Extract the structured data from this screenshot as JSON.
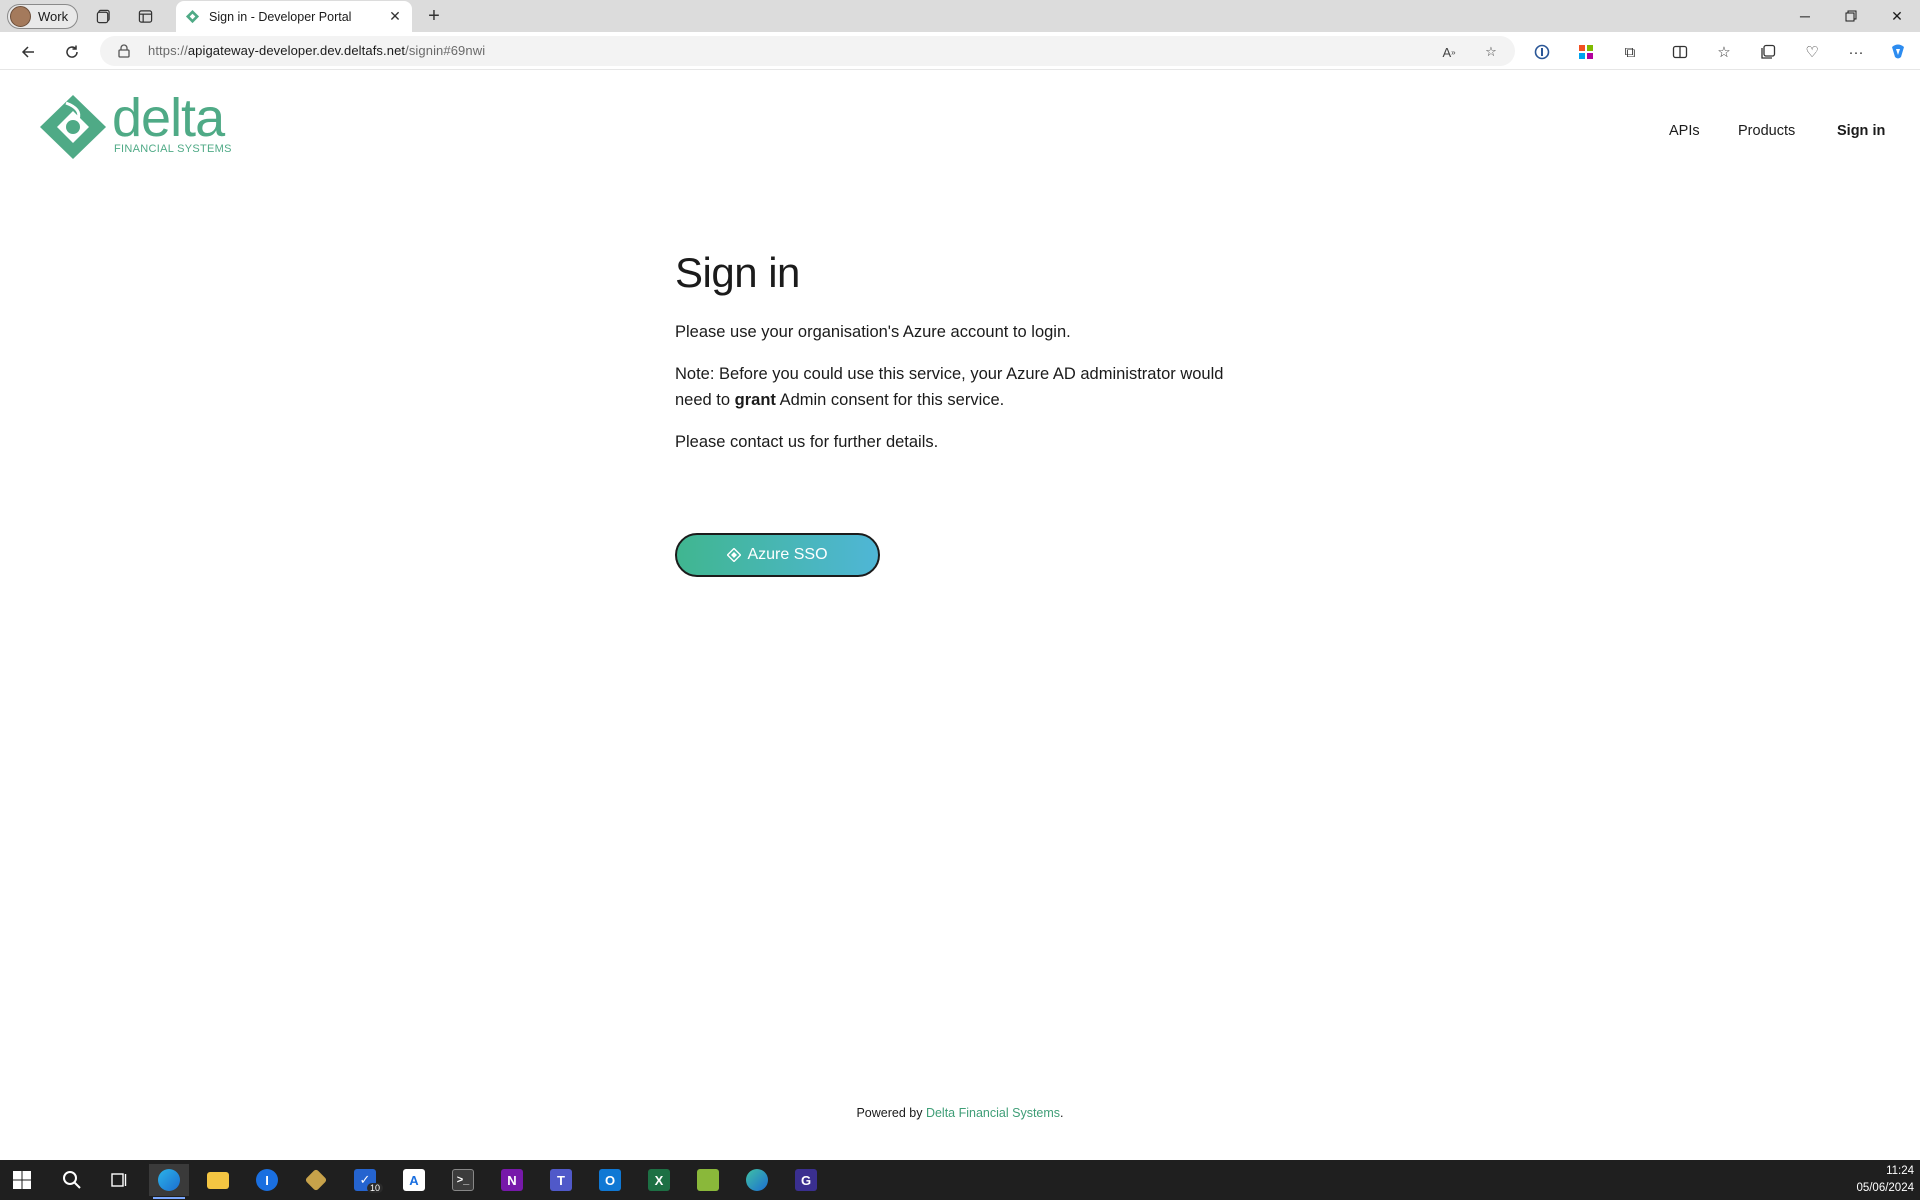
{
  "browser": {
    "profile_label": "Work",
    "tab_title": "Sign in - Developer Portal",
    "url_proto": "https://",
    "url_host": "apigateway-developer.dev.deltafs.net",
    "url_path": "/signin#69nwi"
  },
  "site": {
    "logo_word": "delta",
    "logo_sub": "FINANCIAL SYSTEMS",
    "nav": [
      "APIs",
      "Products",
      "Sign in"
    ]
  },
  "main": {
    "title": "Sign in",
    "para1": "Please use your organisation's Azure account to login.",
    "para2_before": "Note: Before you could use this service, your Azure AD administrator would need to ",
    "para2_bold": "grant",
    "para2_after": " Admin consent for this service.",
    "para3": "Please contact us for further details.",
    "sso_label": "Azure SSO"
  },
  "footer": {
    "prefix": "Powered by ",
    "link": "Delta Financial Systems",
    "suffix": "."
  },
  "taskbar": {
    "time": "11:24",
    "date": "05/06/2024",
    "todo_badge": "10"
  },
  "colors": {
    "brand_green": "#4faa86",
    "button_gradient_start": "#40b690",
    "button_gradient_end": "#4fb6d6"
  }
}
